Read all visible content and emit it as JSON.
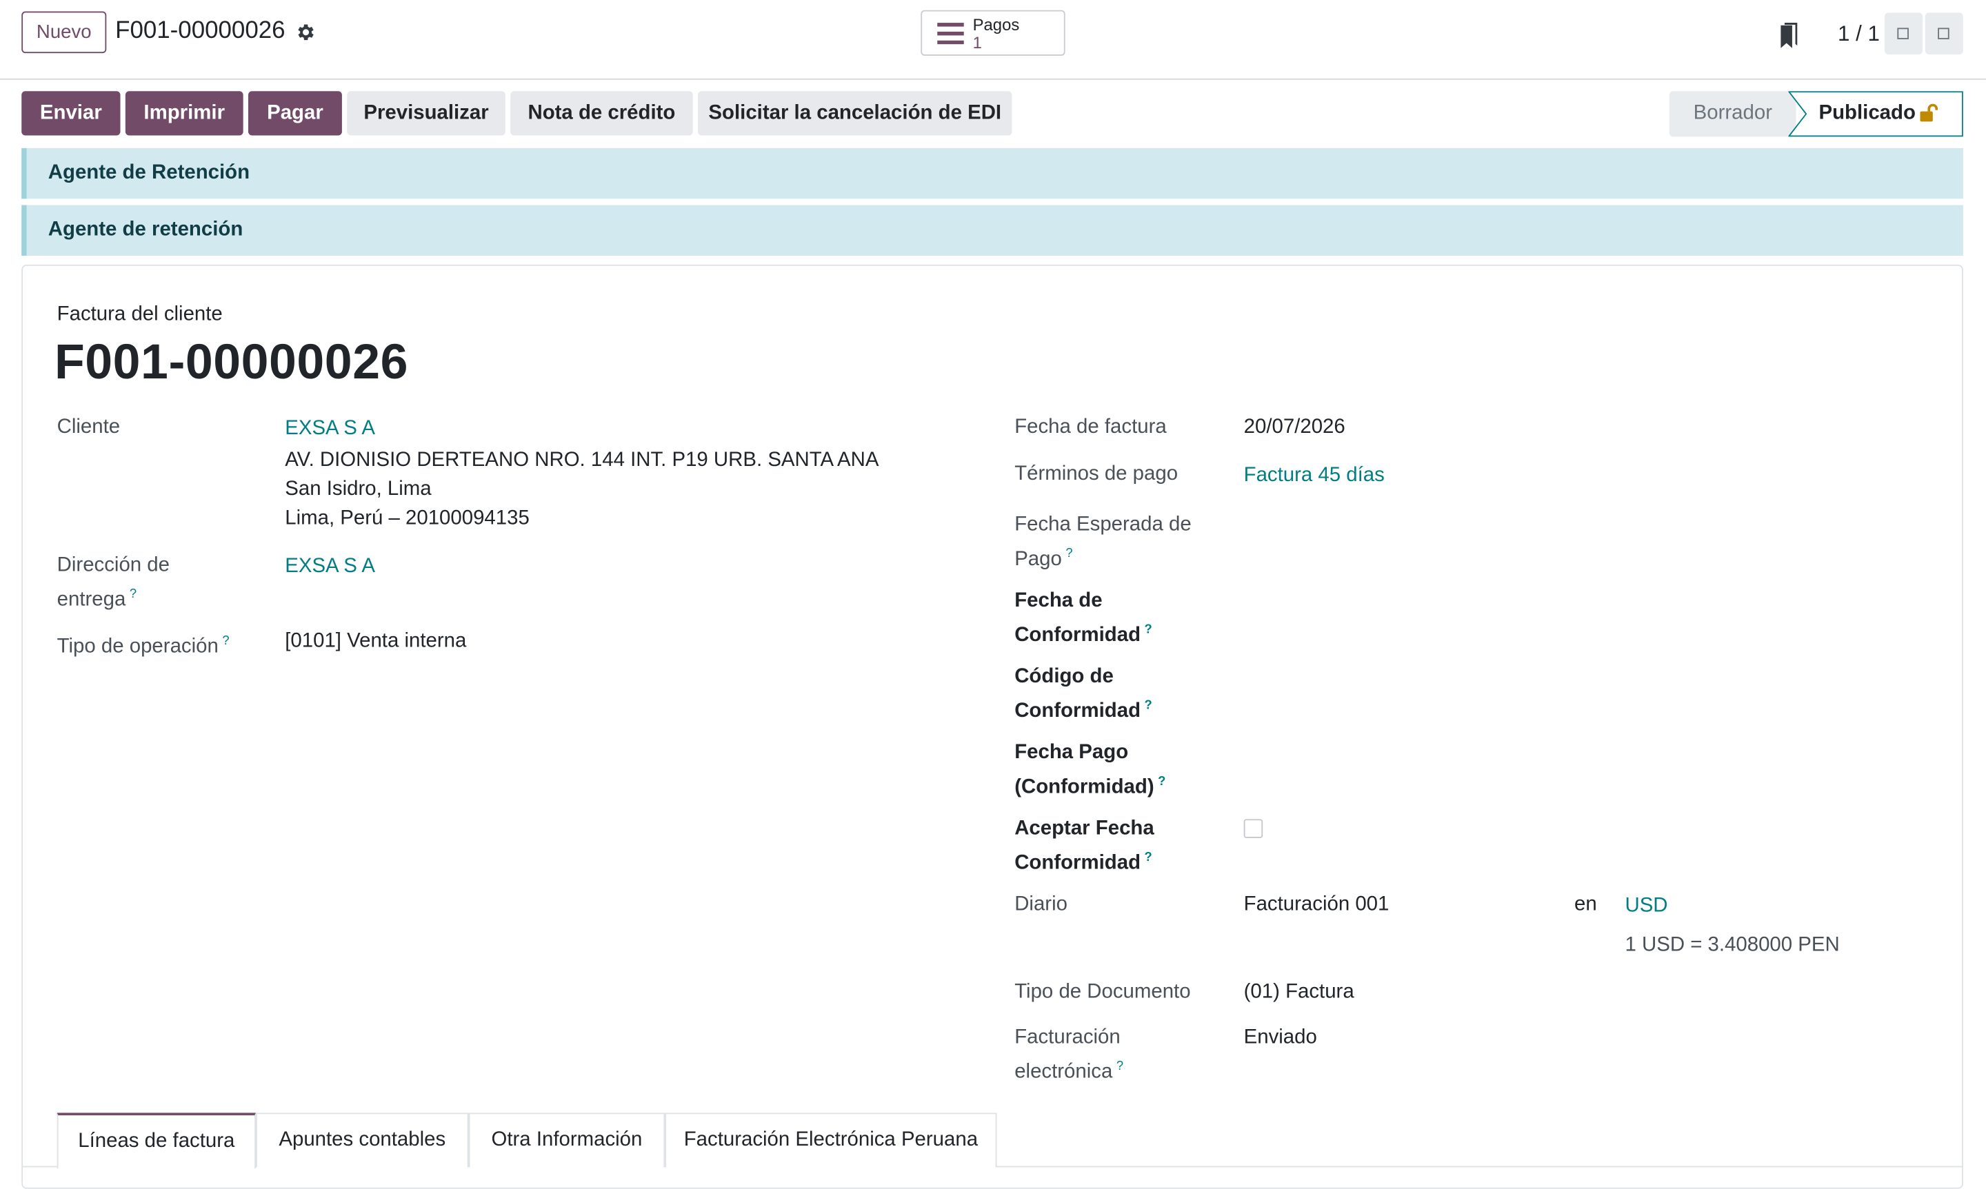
{
  "topbar": {
    "new_label": "Nuevo",
    "record_title": "F001-00000026",
    "smart_button": {
      "label": "Pagos",
      "count": "1",
      "icon": "list-icon"
    },
    "pager": "1 / 1"
  },
  "actions": {
    "send": "Enviar",
    "print": "Imprimir",
    "pay": "Pagar",
    "preview": "Previsualizar",
    "credit_note": "Nota de crédito",
    "edi_cancel": "Solicitar la cancelación de EDI"
  },
  "status": {
    "draft": "Borrador",
    "posted": "Publicado"
  },
  "alerts": [
    "Agente de Retención",
    "Agente de retención"
  ],
  "document": {
    "type_label": "Factura del cliente",
    "name": "F001-00000026"
  },
  "left": {
    "customer_label": "Cliente",
    "customer_name": "EXSA S A",
    "address_line1": "AV. DIONISIO DERTEANO NRO. 144 INT. P19 URB. SANTA ANA",
    "address_line2": "San Isidro, Lima",
    "address_line3": "Lima, Perú – 20100094135",
    "delivery_label_1": "Dirección de",
    "delivery_label_2": "entrega",
    "delivery_value": "EXSA S A",
    "operation_label": "Tipo de operación",
    "operation_value": "[0101] Venta interna",
    "help_mark": "?"
  },
  "right": {
    "invoice_date_label": "Fecha de factura",
    "invoice_date": "20/07/2026",
    "payment_terms_label": "Términos de pago",
    "payment_terms": "Factura 45 días",
    "expected_date_label_1": "Fecha Esperada de",
    "expected_date_label_2": "Pago",
    "conformity_date_label_1": "Fecha de",
    "conformity_date_label_2": "Conformidad",
    "conformity_code_label_1": "Código de",
    "conformity_code_label_2": "Conformidad",
    "payment_conformity_label_1": "Fecha Pago",
    "payment_conformity_label_2": "(Conformidad)",
    "accept_conformity_label_1": "Aceptar Fecha",
    "accept_conformity_label_2": "Conformidad",
    "journal_label": "Diario",
    "journal_value": "Facturación 001",
    "currency_in": "en",
    "currency": "USD",
    "exchange_rate": "1 USD = 3.408000 PEN",
    "doc_type_label": "Tipo de Documento",
    "doc_type_value": "(01) Factura",
    "einvoice_label_1": "Facturación",
    "einvoice_label_2": "electrónica",
    "einvoice_value": "Enviado"
  },
  "tabs": [
    "Líneas de factura",
    "Apuntes contables",
    "Otra Información",
    "Facturación Electrónica Peruana"
  ],
  "colors": {
    "brand": "#714B67",
    "link": "#017e84",
    "alert_bg": "#d2e9ef",
    "alert_text": "#113d47"
  }
}
